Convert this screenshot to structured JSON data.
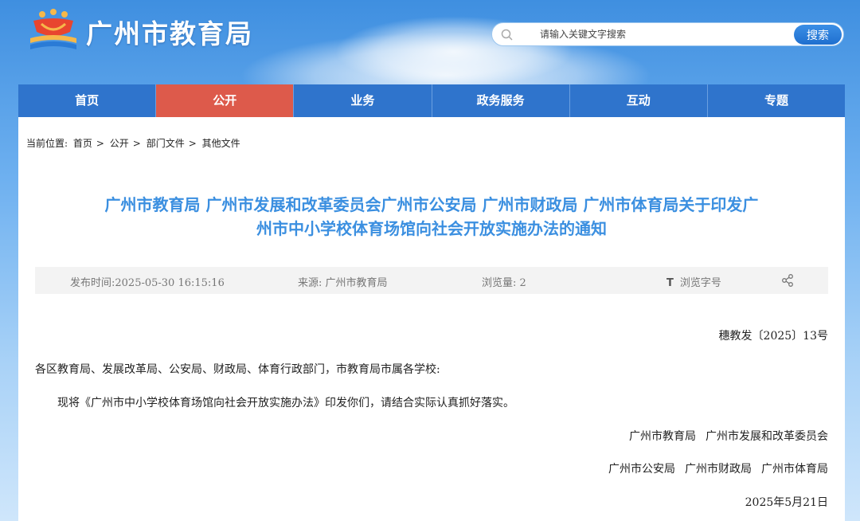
{
  "header": {
    "site_title": "广州市教育局",
    "search": {
      "placeholder": "请输入关键文字搜索",
      "button_label": "搜索"
    }
  },
  "nav": {
    "items": [
      {
        "label": "首页"
      },
      {
        "label": "公开",
        "active": true
      },
      {
        "label": "业务"
      },
      {
        "label": "政务服务"
      },
      {
        "label": "互动"
      },
      {
        "label": "专题"
      }
    ]
  },
  "breadcrumb": {
    "prefix": "当前位置:",
    "items": [
      "首页",
      "公开",
      "部门文件",
      "其他文件"
    ],
    "separator": ">"
  },
  "article": {
    "title_line1": "广州市教育局 广州市发展和改革委员会广州市公安局 广州市财政局 广州市体育局关于印发广",
    "title_line2": "州市中小学校体育场馆向社会开放实施办法的通知",
    "meta": {
      "publish_time": "发布时间:2025-05-30 16:15:16",
      "source": "来源: 广州市教育局",
      "views": "浏览量: 2",
      "font_size_label": "浏览字号",
      "font_size_icon_glyph": "T"
    },
    "doc_number": "穗教发〔2025〕13号",
    "salutation": "各区教育局、发展改革局、公安局、财政局、体育行政部门，市教育局市属各学校:",
    "body": "现将《广州市中小学校体育场馆向社会开放实施办法》印发你们，请结合实际认真抓好落实。",
    "signatories": {
      "line1_a": "广州市教育局",
      "line1_b": "广州市发展和改革委员会",
      "line2_a": "广州市公安局",
      "line2_b": "广州市财政局",
      "line2_c": "广州市体育局"
    },
    "date": "2025年5月21日"
  },
  "colors": {
    "nav_bg": "#2f74cc",
    "nav_active": "#dd5a4b",
    "title_blue": "#3b8fe0",
    "meta_bg": "#f3f3f3"
  }
}
